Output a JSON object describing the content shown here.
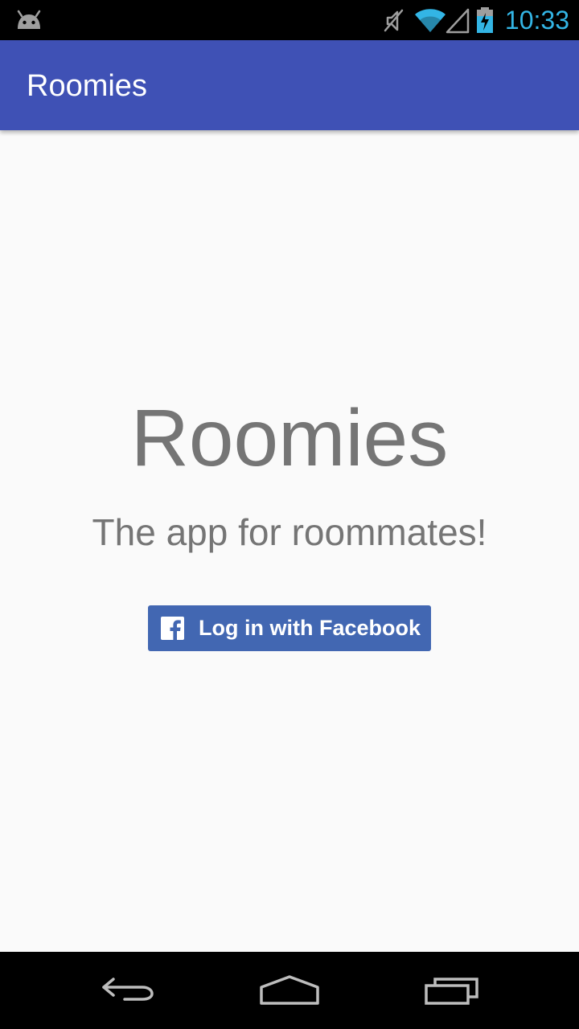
{
  "status_bar": {
    "time": "10:33",
    "icons": [
      "android-icon",
      "mute-icon",
      "wifi-icon",
      "signal-icon",
      "battery-charging-icon"
    ],
    "time_color": "#33b5e5"
  },
  "app_bar": {
    "title": "Roomies",
    "color": "#3f51b5"
  },
  "main": {
    "title": "Roomies",
    "subtitle": "The app for roommates!",
    "login_button": {
      "label": "Log in with Facebook",
      "icon": "facebook-icon",
      "color": "#4267b2"
    }
  },
  "nav_bar": {
    "buttons": [
      "back-icon",
      "home-icon",
      "recents-icon"
    ]
  }
}
